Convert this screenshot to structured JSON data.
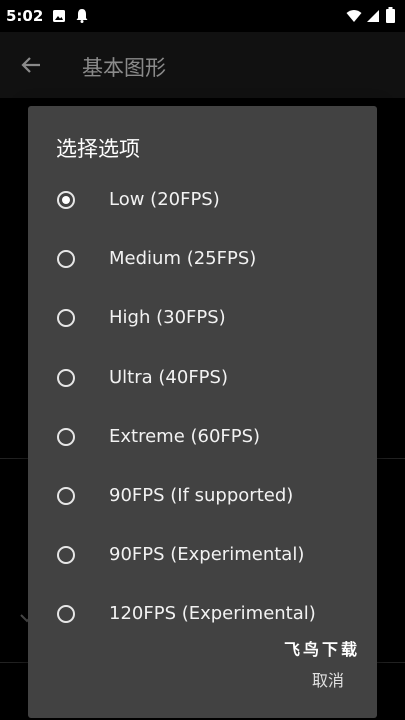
{
  "status_bar": {
    "time": "5:02",
    "icons": [
      "image-icon",
      "notification-icon",
      "wifi-icon",
      "signal-icon",
      "battery-icon"
    ]
  },
  "app_bar": {
    "title": "基本图形",
    "back_icon": "arrow-back-icon"
  },
  "dialog": {
    "title": "选择选项",
    "selected_index": 0,
    "options": [
      {
        "label": "Low (20FPS)",
        "checked": true
      },
      {
        "label": "Medium (25FPS)",
        "checked": false
      },
      {
        "label": "High (30FPS)",
        "checked": false
      },
      {
        "label": "Ultra (40FPS)",
        "checked": false
      },
      {
        "label": "Extreme (60FPS)",
        "checked": false
      },
      {
        "label": "90FPS (If supported)",
        "checked": false
      },
      {
        "label": "90FPS (Experimental)",
        "checked": false
      },
      {
        "label": "120FPS (Experimental)",
        "checked": false
      }
    ],
    "cancel_label": "取消",
    "watermark": "飞鸟下载"
  },
  "colors": {
    "background": "#000000",
    "dialog": "#424242",
    "text": "#ffffff"
  }
}
